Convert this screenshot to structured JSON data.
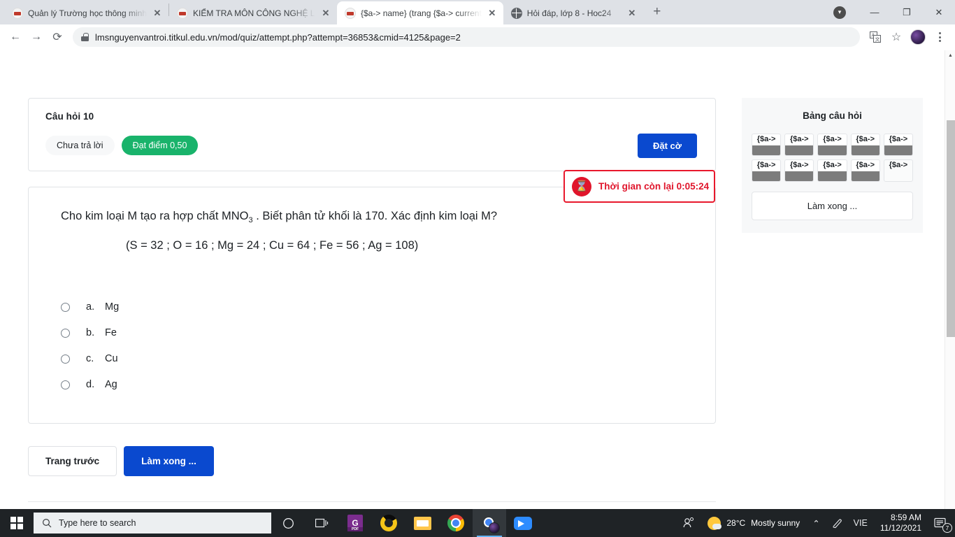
{
  "browser": {
    "tabs": [
      {
        "title": "Quản lý Trường học thông minh",
        "favicon": "school-icon",
        "active": false
      },
      {
        "title": "KIỂM TRA MÔN CÔNG NGHỆ LỚ",
        "favicon": "school-icon",
        "active": false
      },
      {
        "title": "{$a-> name} (trang {$a-> current",
        "favicon": "school-icon",
        "active": true
      },
      {
        "title": "Hỏi đáp, lớp 8 - Hoc24",
        "favicon": "globe-icon",
        "active": false
      }
    ],
    "new_tab_label": "+",
    "tab_close_label": "✕",
    "window_controls": {
      "minimize": "—",
      "maximize": "❐",
      "close": "✕",
      "download_chevron": "▾"
    },
    "nav": {
      "back": "←",
      "forward": "→",
      "reload": "⟳"
    },
    "url": {
      "host": "lmsnguyenvantroi.titkul.edu.vn",
      "path": "/mod/quiz/attempt.php?attempt=36853&cmid=4125&page=2",
      "full": "lmsnguyenvantroi.titkul.edu.vn/mod/quiz/attempt.php?attempt=36853&cmid=4125&page=2"
    },
    "toolbar_right": {
      "translate": "translate-icon",
      "bookmark": "☆",
      "menu": "kebab-menu-icon"
    }
  },
  "quiz": {
    "question_number_label": "Câu hỏi 10",
    "status_badge": "Chưa trả lời",
    "score_badge": "Đạt điểm 0,50",
    "hidden_button_label": "Đặt cờ",
    "question_text_pre": "Cho kim loại M tạo ra hợp chất MNO",
    "question_text_sub": "3",
    "question_text_post": " . Biết phân tử khối là 170. Xác định kim loại M?",
    "question_hint": "(S = 32 ; O = 16 ; Mg = 24 ; Cu = 64 ; Fe = 56 ; Ag = 108)",
    "options": [
      {
        "letter": "a.",
        "text": "Mg",
        "selected": false
      },
      {
        "letter": "b.",
        "text": "Fe",
        "selected": false
      },
      {
        "letter": "c.",
        "text": "Cu",
        "selected": false
      },
      {
        "letter": "d.",
        "text": "Ag",
        "selected": false
      }
    ],
    "prev_button": "Trang trước",
    "finish_button": "Làm xong ..."
  },
  "timer": {
    "text": "Thời gian còn lại 0:05:24",
    "icon": "hourglass-icon",
    "accent_color": "#e0152b"
  },
  "sidebar": {
    "title": "Bảng câu hỏi",
    "cells": [
      {
        "label": "{$a->",
        "state": "answered"
      },
      {
        "label": "{$a->",
        "state": "answered"
      },
      {
        "label": "{$a->",
        "state": "answered"
      },
      {
        "label": "{$a->",
        "state": "answered"
      },
      {
        "label": "{$a->",
        "state": "answered"
      },
      {
        "label": "{$a->",
        "state": "answered"
      },
      {
        "label": "{$a->",
        "state": "answered"
      },
      {
        "label": "{$a->",
        "state": "answered"
      },
      {
        "label": "{$a->",
        "state": "answered"
      },
      {
        "label": "{$a->",
        "state": "empty"
      }
    ],
    "finish_button": "Làm xong ..."
  },
  "taskbar": {
    "search_placeholder": "Type here to search",
    "search_icon": "search-icon",
    "start_icon": "windows-start-icon",
    "cortana_icon": "cortana-circle-icon",
    "taskview_icon": "task-view-icon",
    "apps": [
      {
        "name": "gpdf-icon",
        "label": "G"
      },
      {
        "name": "edge-icon",
        "label": ""
      },
      {
        "name": "file-explorer-icon",
        "label": ""
      },
      {
        "name": "chrome-icon",
        "label": ""
      },
      {
        "name": "chrome-profile-icon",
        "label": "",
        "active": true
      },
      {
        "name": "zoom-icon",
        "label": ""
      }
    ],
    "tray": {
      "people_icon": "people-icon",
      "weather_temp": "28°C",
      "weather_desc": "Mostly sunny",
      "chevron": "⌃",
      "pen_icon": "pen-icon",
      "language": "VIE",
      "time": "8:59 AM",
      "date": "11/12/2021",
      "notification_count": "7"
    }
  }
}
